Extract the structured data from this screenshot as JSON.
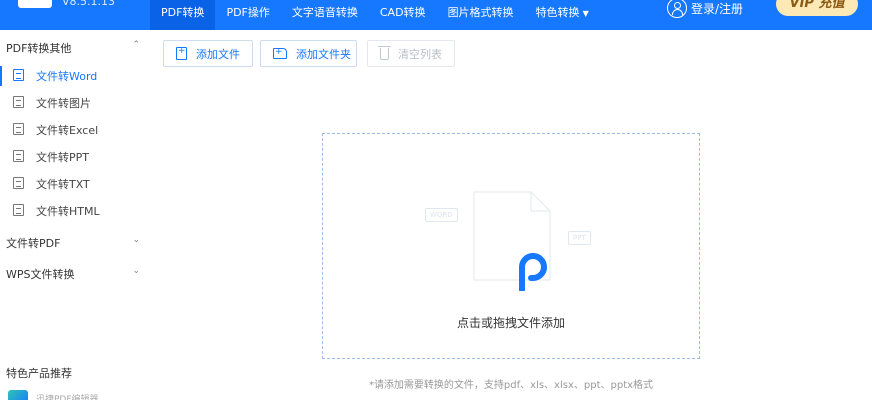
{
  "app": {
    "version": "V8.5.1.13",
    "colors": {
      "primary": "#1677ff",
      "active_tab": "#0a63e6",
      "vip_bg": "#fde9b6"
    }
  },
  "nav": {
    "tabs": [
      {
        "label": "PDF转换",
        "active": true
      },
      {
        "label": "PDF操作"
      },
      {
        "label": "文字语音转换"
      },
      {
        "label": "CAD转换"
      },
      {
        "label": "图片格式转换"
      },
      {
        "label": "特色转换",
        "dropdown": true
      }
    ],
    "login_label": "登录/注册",
    "vip_label": "VIP 充值"
  },
  "sidebar": {
    "group1": {
      "title": "PDF转换其他",
      "expanded": true
    },
    "items": [
      {
        "label": "文件转Word",
        "icon": "word-file-icon",
        "active": true
      },
      {
        "label": "文件转图片",
        "icon": "image-file-icon"
      },
      {
        "label": "文件转Excel",
        "icon": "excel-file-icon"
      },
      {
        "label": "文件转PPT",
        "icon": "ppt-file-icon"
      },
      {
        "label": "文件转TXT",
        "icon": "txt-file-icon"
      },
      {
        "label": "文件转HTML",
        "icon": "html-file-icon"
      }
    ],
    "group2": {
      "title": "文件转PDF",
      "expanded": false
    },
    "group3": {
      "title": "WPS文件转换",
      "expanded": false
    },
    "promo_title": "特色产品推荐",
    "promo_text": "迅捷PDF编辑器"
  },
  "toolbar": {
    "add_file": "添加文件",
    "add_folder": "添加文件夹",
    "clear_list": "清空列表"
  },
  "dropzone": {
    "label": "点击或拖拽文件添加",
    "tags": [
      "WORD",
      "PPT"
    ]
  },
  "hint": "*请添加需要转换的文件，支持pdf、xls、xlsx、ppt、pptx格式"
}
